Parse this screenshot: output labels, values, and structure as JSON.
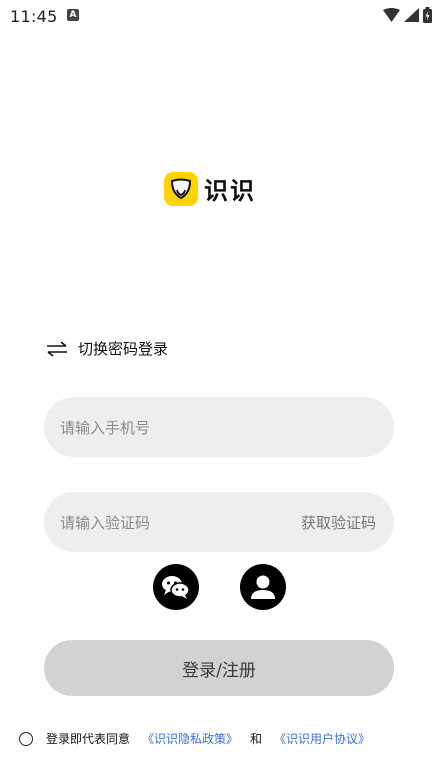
{
  "status_bar": {
    "time": "11:45",
    "notification_icon": "a-icon",
    "icons": [
      "wifi-icon",
      "signal-icon",
      "battery-icon"
    ]
  },
  "brand": {
    "name": "识识",
    "logo_color": "#FFD400"
  },
  "switch_login": {
    "label": "切换密码登录",
    "icon": "switch-arrows-icon"
  },
  "phone": {
    "placeholder": "请输入手机号",
    "value": ""
  },
  "code": {
    "placeholder": "请输入验证码",
    "value": "",
    "get_code_label": "获取验证码"
  },
  "social": [
    "wechat-icon",
    "account-icon"
  ],
  "login_button": {
    "label": "登录/注册"
  },
  "agreement": {
    "prefix": "登录即代表同意",
    "privacy_link": "《识识隐私政策》",
    "and": "和",
    "user_agreement_link": "《识识用户协议》",
    "checked": false,
    "link_color": "#3b6fd6"
  }
}
